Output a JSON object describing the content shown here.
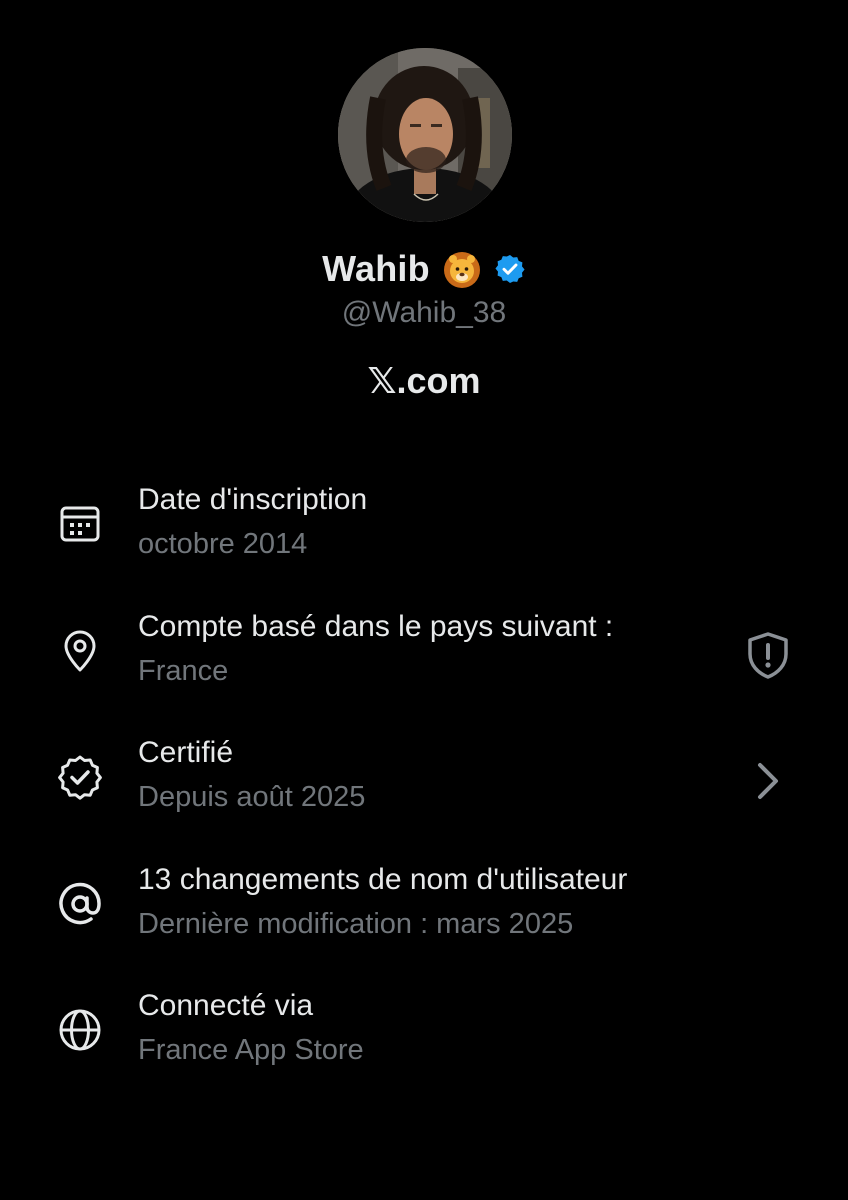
{
  "profile": {
    "display_name": "Wahib",
    "name_emoji_icon": "lion-face-icon",
    "verified_icon": "verified-badge-icon",
    "verified_color": "#1d9bf0",
    "handle": "@Wahib_38",
    "platform": "𝕏.com"
  },
  "info_items": [
    {
      "icon": "calendar-icon",
      "title": "Date d'inscription",
      "subtitle": "octobre 2014"
    },
    {
      "icon": "location-pin-icon",
      "title": "Compte basé dans le pays suivant :",
      "subtitle": "France",
      "trailing_icon": "shield-alert-icon"
    },
    {
      "icon": "verified-badge-outline-icon",
      "title": "Certifié",
      "subtitle": "Depuis août 2025",
      "trailing_icon": "chevron-right-icon"
    },
    {
      "icon": "at-sign-icon",
      "title": "13 changements de nom d'utilisateur",
      "subtitle": "Dernière modification : mars 2025"
    },
    {
      "icon": "globe-icon",
      "title": "Connecté via",
      "subtitle": "France App Store"
    }
  ],
  "colors": {
    "background": "#000000",
    "primary_text": "#e7e9ea",
    "secondary_text": "#71767b",
    "accent_blue": "#1d9bf0"
  }
}
